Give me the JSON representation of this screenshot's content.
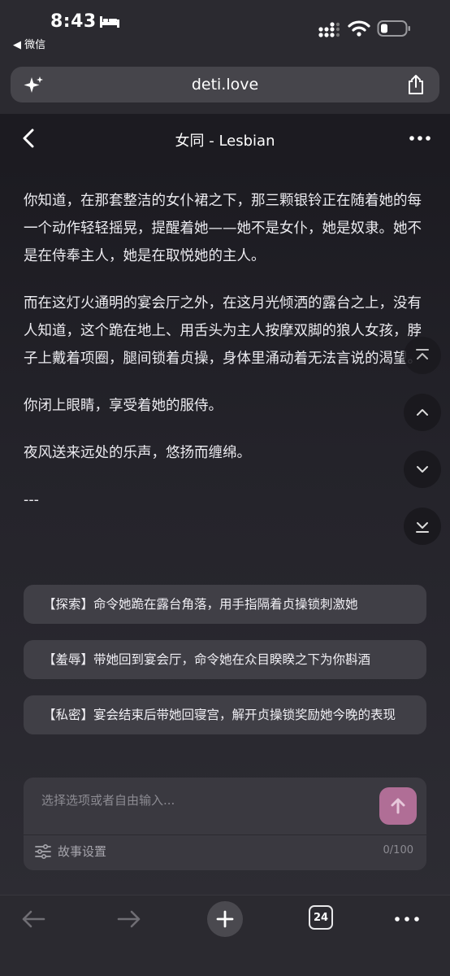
{
  "status_bar": {
    "time": "8:43",
    "back_app": "◀ 微信"
  },
  "browser": {
    "url": "deti.love"
  },
  "header": {
    "title": "女同 - Lesbian"
  },
  "story": {
    "paragraphs": [
      "你知道，在那套整洁的女仆裙之下，那三颗银铃正在随着她的每一个动作轻轻摇晃，提醒着她——她不是女仆，她是奴隶。她不是在侍奉主人，她是在取悦她的主人。",
      "而在这灯火通明的宴会厅之外，在这月光倾洒的露台之上，没有人知道，这个跪在地上、用舌头为主人按摩双脚的狼人女孩，脖子上戴着项圈，腿间锁着贞操，身体里涌动着无法言说的渴望。",
      "你闭上眼睛，享受着她的服侍。",
      "夜风送来远处的乐声，悠扬而缠绵。",
      "---"
    ]
  },
  "options": [
    "【探索】命令她跪在露台角落，用手指隔着贞操锁刺激她",
    "【羞辱】带她回到宴会厅，命令她在众目睽睽之下为你斟酒",
    "【私密】宴会结束后带她回寝宫，解开贞操锁奖励她今晚的表现"
  ],
  "input": {
    "placeholder": "选择选项或者自由输入...",
    "value": "",
    "settings_label": "故事设置",
    "char_count": "0/100"
  },
  "toolbar": {
    "tab_count": "24"
  },
  "icons": {
    "status": [
      "bed-icon",
      "signal-icon",
      "wifi-icon",
      "battery-icon"
    ],
    "url_bar": [
      "sparkle-icon",
      "share-icon"
    ],
    "header": [
      "back-chevron-icon",
      "more-icon"
    ],
    "scroll_nav": [
      "scroll-to-top-icon",
      "scroll-up-icon",
      "scroll-down-icon",
      "scroll-to-bottom-icon"
    ],
    "toolbar": [
      "back-arrow-icon",
      "forward-arrow-icon",
      "plus-icon",
      "tabs-icon",
      "more-icon"
    ]
  },
  "colors": {
    "background": "#232229",
    "option_bg": "#403f46",
    "send_button": "#b06e96"
  }
}
